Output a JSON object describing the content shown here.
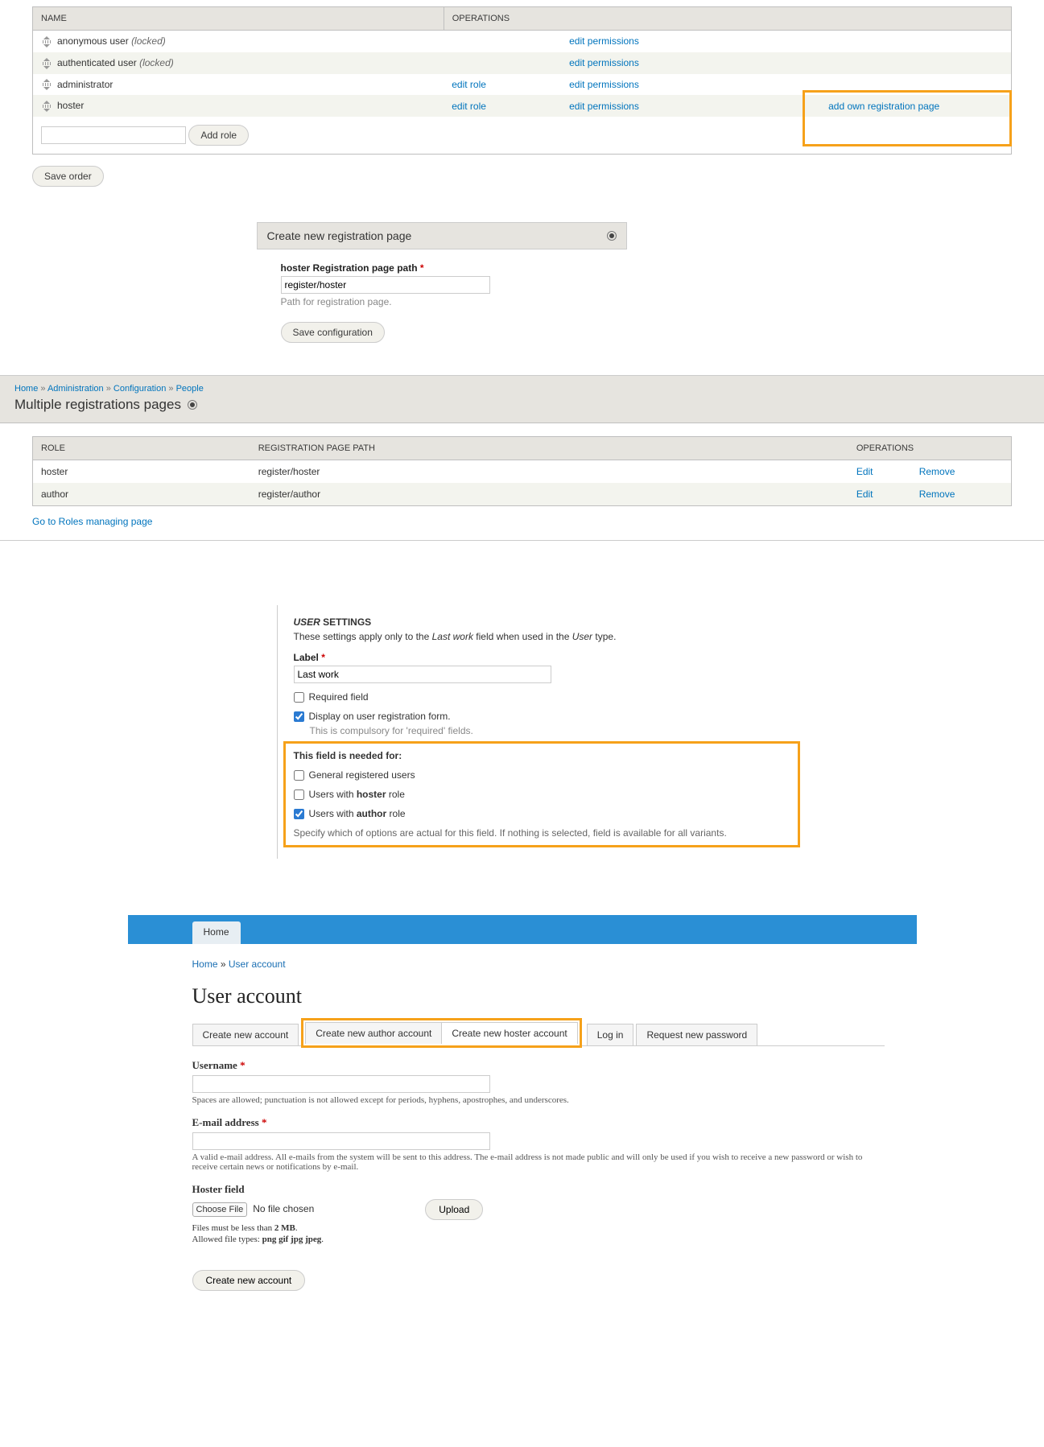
{
  "roles_table": {
    "headers": [
      "NAME",
      "OPERATIONS"
    ],
    "rows": [
      {
        "name": "anonymous user",
        "locked": "(locked)",
        "edit_role": "",
        "edit_perm": "edit permissions",
        "add_page": ""
      },
      {
        "name": "authenticated user",
        "locked": "(locked)",
        "edit_role": "",
        "edit_perm": "edit permissions",
        "add_page": ""
      },
      {
        "name": "administrator",
        "locked": "",
        "edit_role": "edit role",
        "edit_perm": "edit permissions",
        "add_page": ""
      },
      {
        "name": "hoster",
        "locked": "",
        "edit_role": "edit role",
        "edit_perm": "edit permissions",
        "add_page": "add own registration page"
      }
    ],
    "add_role_btn": "Add role",
    "save_order_btn": "Save order"
  },
  "create_page": {
    "title": "Create new registration page",
    "path_label": "hoster Registration page path",
    "path_value": "register/hoster",
    "path_hint": "Path for registration page.",
    "save_btn": "Save configuration"
  },
  "multi_reg": {
    "breadcrumb": {
      "home": "Home",
      "admin": "Administration",
      "config": "Configuration",
      "people": "People",
      "sep": " » "
    },
    "title": "Multiple registrations pages",
    "headers": [
      "ROLE",
      "REGISTRATION PAGE PATH",
      "OPERATIONS"
    ],
    "rows": [
      {
        "role": "hoster",
        "path": "register/hoster",
        "edit": "Edit",
        "remove": "Remove"
      },
      {
        "role": "author",
        "path": "register/author",
        "edit": "Edit",
        "remove": "Remove"
      }
    ],
    "manage_link": "Go to Roles managing page"
  },
  "user_settings": {
    "heading_user": "USER",
    "heading_rest": " SETTINGS",
    "desc_1": "These settings apply only to the ",
    "desc_lw": "Last work",
    "desc_2": " field when used in the ",
    "desc_user": "User",
    "desc_3": " type.",
    "label_lbl": "Label",
    "label_val": "Last work",
    "required_lbl": "Required field",
    "display_lbl": "Display on user registration form.",
    "display_hint": "This is compulsory for 'required' fields.",
    "needed_header": "This field is needed for:",
    "opt_general": "General registered users",
    "opt_hoster_1": "Users with ",
    "opt_hoster_b": "hoster",
    "opt_hoster_2": " role",
    "opt_author_1": "Users with ",
    "opt_author_b": "author",
    "opt_author_2": " role",
    "spec_hint": "Specify which of options are actual for this field. If nothing is selected, field is available for all variants."
  },
  "user_account": {
    "home_tab": "Home",
    "bc_home": "Home",
    "bc_sep": " » ",
    "bc_ua": "User account",
    "title": "User account",
    "tabs": {
      "create": "Create new account",
      "author": "Create new author account",
      "hoster": "Create new hoster account",
      "login": "Log in",
      "request": "Request new password"
    },
    "username_lbl": "Username",
    "username_hint": "Spaces are allowed; punctuation is not allowed except for periods, hyphens, apostrophes, and underscores.",
    "email_lbl": "E-mail address",
    "email_hint": "A valid e-mail address. All e-mails from the system will be sent to this address. The e-mail address is not made public and will only be used if you wish to receive a new password or wish to receive certain news or notifications by e-mail.",
    "hoster_lbl": "Hoster field",
    "choose_file": "Choose File",
    "no_file": "No file chosen",
    "upload_btn": "Upload",
    "file_size_1": "Files must be less than ",
    "file_size_b": "2 MB",
    "file_size_2": ".",
    "allowed_1": "Allowed file types: ",
    "allowed_b": "png gif jpg jpeg",
    "allowed_2": ".",
    "create_btn": "Create new account"
  }
}
